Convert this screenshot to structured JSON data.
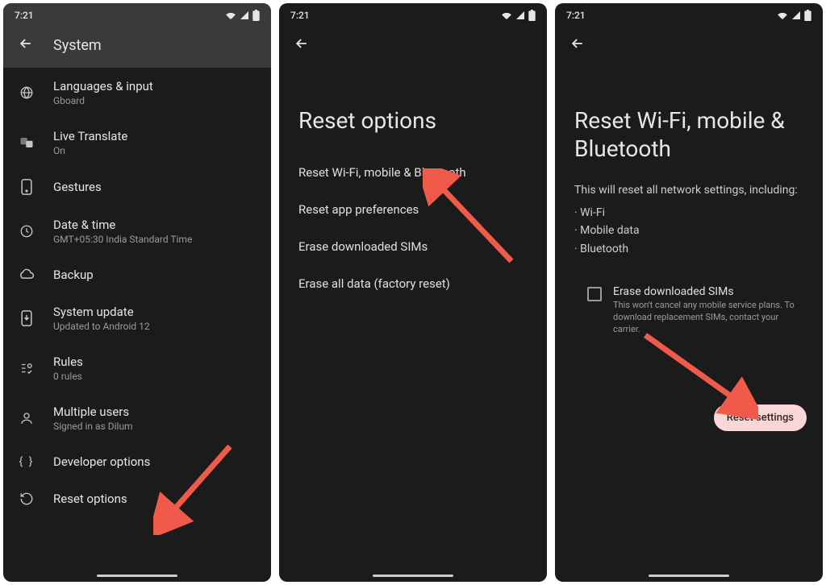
{
  "status": {
    "time": "7:21"
  },
  "screen1": {
    "title": "System",
    "items": [
      {
        "icon": "globe",
        "title": "Languages & input",
        "sub": "Gboard"
      },
      {
        "icon": "translate",
        "title": "Live Translate",
        "sub": "On"
      },
      {
        "icon": "gesture",
        "title": "Gestures",
        "sub": ""
      },
      {
        "icon": "clock",
        "title": "Date & time",
        "sub": "GMT+05:30 India Standard Time"
      },
      {
        "icon": "cloud",
        "title": "Backup",
        "sub": ""
      },
      {
        "icon": "update",
        "title": "System update",
        "sub": "Updated to Android 12"
      },
      {
        "icon": "rules",
        "title": "Rules",
        "sub": "0 rules"
      },
      {
        "icon": "users",
        "title": "Multiple users",
        "sub": "Signed in as Dilum"
      },
      {
        "icon": "code",
        "title": "Developer options",
        "sub": ""
      },
      {
        "icon": "reset",
        "title": "Reset options",
        "sub": ""
      }
    ]
  },
  "screen2": {
    "title": "Reset options",
    "items": [
      "Reset Wi-Fi, mobile & Bluetooth",
      "Reset app preferences",
      "Erase downloaded SIMs",
      "Erase all data (factory reset)"
    ]
  },
  "screen3": {
    "title": "Reset Wi-Fi, mobile & Bluetooth",
    "desc": "This will reset all network settings, including:",
    "bullets": [
      "Wi-Fi",
      "Mobile data",
      "Bluetooth"
    ],
    "check_title": "Erase downloaded SIMs",
    "check_sub": "This won't cancel any mobile service plans. To download replacement SIMs, contact your carrier.",
    "button": "Reset settings"
  }
}
